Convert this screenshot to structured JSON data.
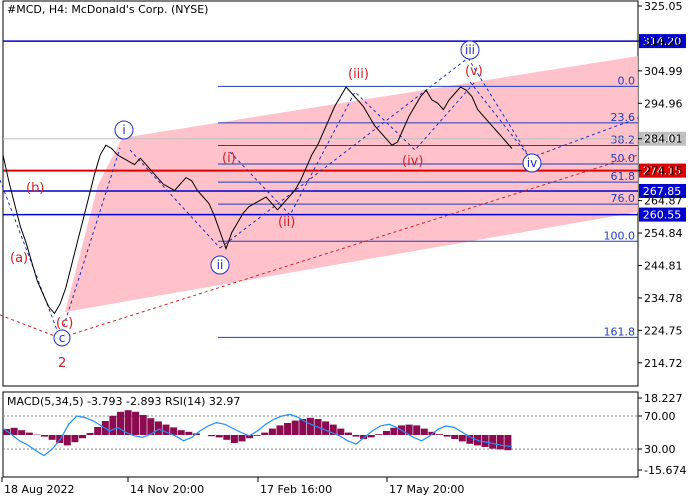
{
  "header": {
    "title": "#MCD, H4:  McDonald's Corp. (NYSE)",
    "indicator": "MACD(5,34,5) -3.793 -2.893 RSI(14) 32.97"
  },
  "colors": {
    "background": "#ffffff",
    "channel": "#ffb6c1",
    "price_line": "#000000",
    "fib_lines": "#1f3fbf",
    "wave_red": "#d0202a",
    "wave_blue": "#1f2fbf",
    "level_red": "#e00000",
    "level_blue": "#0000cc",
    "macd_hist": "#8b0a50",
    "rsi_line": "#1e90ff"
  },
  "chart_data": [
    {
      "type": "line",
      "pane": "price",
      "ylim": [
        209.4,
        325.05
      ],
      "y_ticks": [
        "325.05",
        "314.20",
        "304.99",
        "294.96",
        "284.01",
        "274.15",
        "264.87",
        "254.84",
        "244.81",
        "234.78",
        "224.75",
        "214.72"
      ],
      "x_ticks": [
        "18 Aug 2022",
        "14 Nov 20:00",
        "17 Feb 16:00",
        "17 May 20:00"
      ],
      "series": [
        {
          "values": [
            279,
            271,
            264,
            257,
            252,
            246,
            240,
            236,
            232,
            230,
            233,
            238,
            245,
            252,
            259,
            266,
            273,
            279,
            282,
            281,
            279,
            278,
            277,
            276,
            278,
            276,
            274,
            272,
            270,
            269,
            268,
            270,
            272,
            271,
            268,
            266,
            264,
            260,
            255,
            250,
            255,
            258,
            261,
            263,
            264,
            265,
            266,
            264,
            262,
            264,
            266,
            268,
            271,
            275,
            279,
            282,
            286,
            290,
            294,
            297,
            300,
            298,
            296,
            294,
            291,
            288,
            286,
            284,
            282,
            283,
            287,
            291,
            294,
            297,
            299,
            296,
            295,
            293,
            296,
            298,
            300,
            299,
            297,
            293,
            291,
            289,
            287,
            285,
            283,
            281
          ]
        }
      ],
      "price_levels": [
        {
          "label": "314.20",
          "value": 314.2,
          "style": "blue"
        },
        {
          "label": "274.15",
          "value": 274.15,
          "style": "red"
        },
        {
          "label": "267.85",
          "value": 267.85,
          "style": "blue"
        },
        {
          "label": "260.55",
          "value": 260.55,
          "style": "blue"
        }
      ],
      "current_price": "284.01",
      "fibonacci": [
        {
          "label": "0.0",
          "value": 300.2
        },
        {
          "label": "23.6",
          "value": 288.9
        },
        {
          "label": "38.2",
          "value": 281.9
        },
        {
          "label": "50.0",
          "value": 276.2
        },
        {
          "label": "61.8",
          "value": 270.6
        },
        {
          "label": "76.0",
          "value": 263.8
        },
        {
          "label": "100.0",
          "value": 252.3
        },
        {
          "label": "161.8",
          "value": 222.6
        }
      ],
      "wave_labels": [
        "(iii)",
        "(v)",
        "(iv)",
        "(i)",
        "(ii)",
        "(a)",
        "(b)",
        "(c)",
        "2"
      ],
      "wave_labels_circled": [
        "i",
        "ii",
        "iii",
        "iv",
        "c"
      ]
    },
    {
      "type": "bar",
      "pane": "indicator",
      "y_ticks": [
        "18.227",
        "70.00",
        "30.00",
        "-15.674"
      ],
      "series": [
        {
          "name": "MACD",
          "values": [
            1.5,
            1.8,
            1.2,
            0.6,
            0.1,
            -0.4,
            -1.2,
            -2.0,
            -2.6,
            -1.8,
            -0.8,
            0.5,
            2.0,
            3.5,
            4.8,
            5.8,
            6.2,
            5.8,
            5.0,
            4.2,
            3.4,
            2.6,
            1.9,
            1.2,
            0.8,
            0.4,
            0.0,
            -0.3,
            -0.6,
            -1.2,
            -2.0,
            -1.6,
            -0.8,
            -0.2,
            0.6,
            1.6,
            2.4,
            3.0,
            3.6,
            4.0,
            4.3,
            4.0,
            3.4,
            2.6,
            1.6,
            0.6,
            -0.4,
            -1.0,
            -0.6,
            0.2,
            1.0,
            1.8,
            2.4,
            2.6,
            2.4,
            1.6,
            0.8,
            0.2,
            -0.4,
            -1.0,
            -1.6,
            -2.2,
            -2.6,
            -3.0,
            -3.4,
            -3.6,
            -3.8
          ]
        },
        {
          "name": "RSI",
          "values": [
            55,
            48,
            40,
            35,
            28,
            22,
            30,
            42,
            60,
            70,
            68,
            64,
            58,
            52,
            56,
            50,
            46,
            44,
            48,
            54,
            50,
            46,
            40,
            44,
            52,
            58,
            62,
            60,
            55,
            50,
            46,
            52,
            60,
            66,
            70,
            72,
            68,
            62,
            58,
            54,
            50,
            46,
            40,
            36,
            44,
            52,
            58,
            60,
            56,
            50,
            44,
            40,
            46,
            54,
            58,
            56,
            50,
            44,
            40,
            38,
            36,
            34,
            33
          ]
        }
      ]
    }
  ]
}
